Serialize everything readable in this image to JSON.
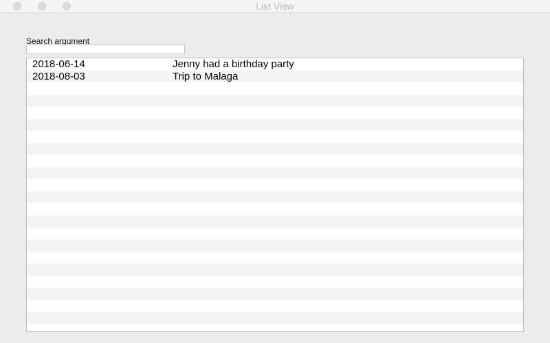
{
  "window": {
    "title": "List View"
  },
  "search": {
    "label": "Search argument",
    "value": "",
    "placeholder": ""
  },
  "list": {
    "rows": [
      {
        "date": "2018-06-14",
        "description": "Jenny had a birthday party"
      },
      {
        "date": "2018-08-03",
        "description": "Trip to Malaga"
      }
    ]
  }
}
